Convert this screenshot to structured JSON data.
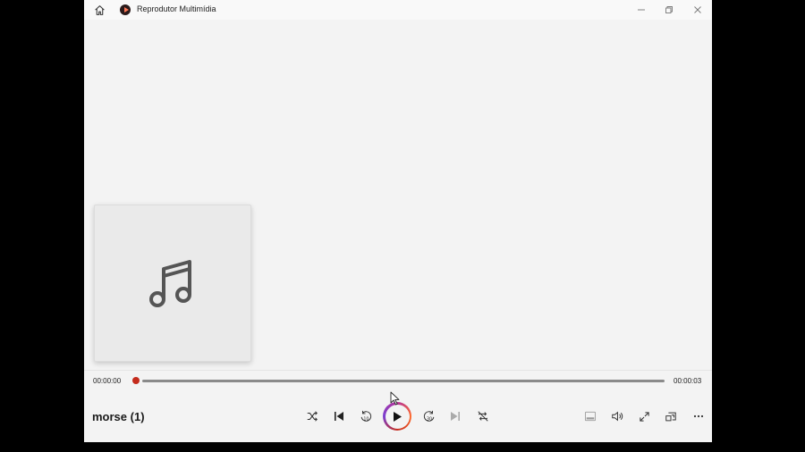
{
  "window": {
    "title": "Reprodutor Multimídia",
    "controls": {
      "minimize": "minimize-icon",
      "maximize": "restore-icon",
      "close": "close-icon"
    }
  },
  "album_art": {
    "icon": "music-note-icon"
  },
  "playback": {
    "current_time": "00:00:00",
    "total_time": "00:00:03",
    "progress_fraction": 0.0,
    "accent_color": "#c42b1c"
  },
  "now_playing": {
    "title": "morse (1)"
  },
  "controls": {
    "shuffle": "shuffle-icon",
    "previous": "previous-icon",
    "rewind": "rewind-10-icon",
    "play": "play-icon",
    "forward": "forward-30-icon",
    "next": "next-icon",
    "repeat": "repeat-off-icon",
    "miniplayer": "miniplayer-icon",
    "volume": "volume-icon",
    "fullscreen": "fullscreen-icon",
    "cast": "cast-icon",
    "more": "more-icon"
  }
}
